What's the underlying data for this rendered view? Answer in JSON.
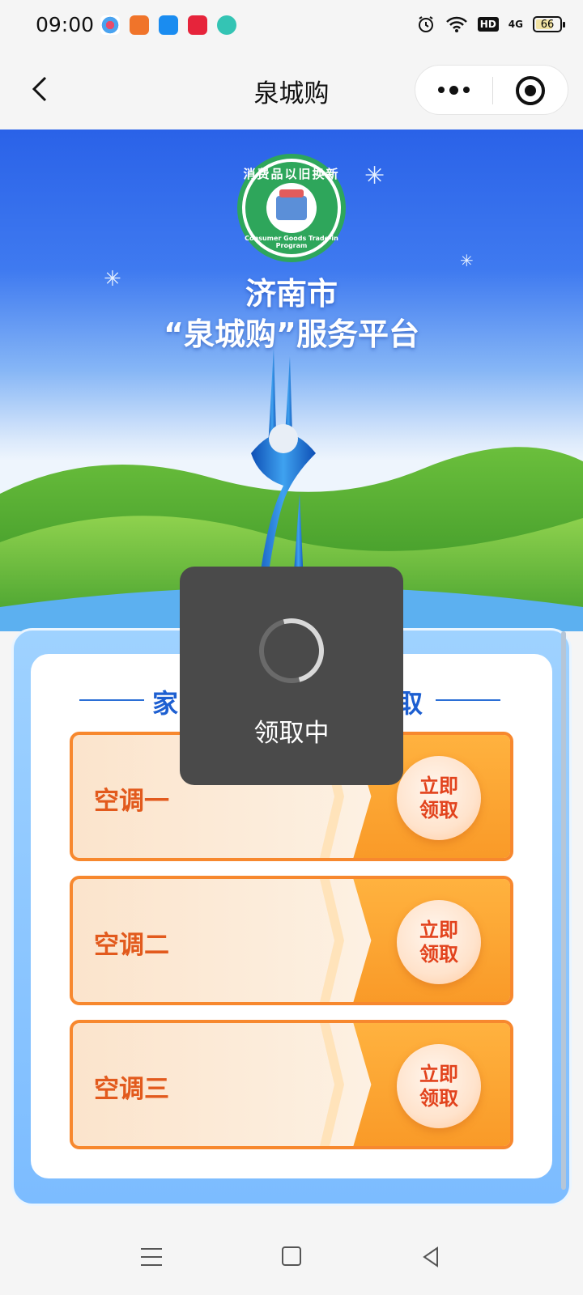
{
  "status_bar": {
    "time": "09:00",
    "network": "HD",
    "signal": "4G",
    "battery": "66",
    "icons": [
      "alarm-icon",
      "wifi-icon",
      "hd-icon",
      "signal-icon",
      "battery-icon"
    ],
    "app_icons": [
      "app-icon-1",
      "app-icon-2",
      "app-icon-3",
      "app-icon-4",
      "app-icon-5"
    ]
  },
  "nav": {
    "title": "泉城购"
  },
  "hero": {
    "logo_top": "消费品以旧换新",
    "logo_bottom": "Consumer Goods Trade-in Program",
    "title_line1": "济南市",
    "title_line2": "“泉城购”服务平台"
  },
  "section": {
    "title_left": "家",
    "title_right": "取"
  },
  "coupons": [
    {
      "label": "空调一",
      "btn_line1": "立即",
      "btn_line2": "领取"
    },
    {
      "label": "空调二",
      "btn_line1": "立即",
      "btn_line2": "领取"
    },
    {
      "label": "空调三",
      "btn_line1": "立即",
      "btn_line2": "领取"
    }
  ],
  "toast": {
    "text": "领取中"
  },
  "colors": {
    "accent_blue": "#1d5fd1",
    "coupon_orange": "#f99a28",
    "coupon_text": "#e25a1d",
    "toast_bg": "#4a4a4a"
  }
}
